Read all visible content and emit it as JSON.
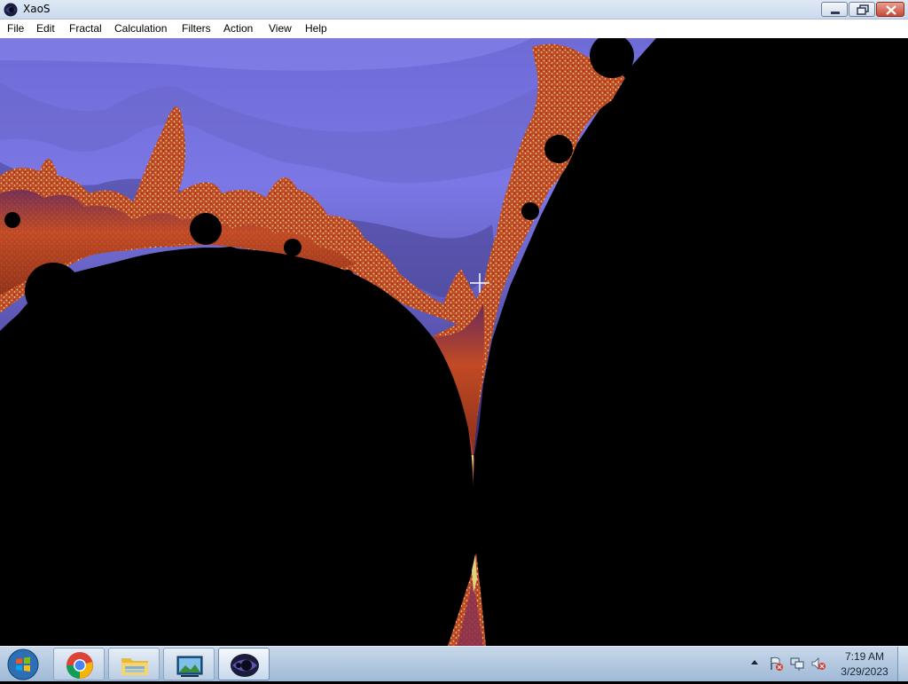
{
  "window": {
    "title": "XaoS",
    "icon": "xaos-app-icon",
    "controls": [
      "minimize-icon",
      "restore-icon",
      "close-icon"
    ]
  },
  "menu": {
    "items": [
      "File",
      "Edit",
      "Fractal",
      "Calculation",
      "Filters",
      "Action",
      "View",
      "Help"
    ]
  },
  "canvas": {
    "content": "mandelbrot-fractal",
    "cursor": "crosshair-icon",
    "colors": {
      "background": "#000000",
      "lavender_light": "#7b78e6",
      "lavender_mid": "#6a66c8",
      "lavender_dark": "#4a4495",
      "purple_deep": "#2f2566",
      "orange": "#c24a24",
      "orange_dark": "#8a2e18",
      "yellow_speckle": "#e0d27a"
    }
  },
  "taskbar": {
    "start_icon": "windows-start-icon",
    "apps": [
      {
        "name": "chrome",
        "icon": "chrome-icon"
      },
      {
        "name": "explorer",
        "icon": "folder-icon"
      },
      {
        "name": "photos",
        "icon": "picture-icon"
      },
      {
        "name": "xaos",
        "icon": "xaos-icon",
        "active": true
      }
    ],
    "tray": {
      "arrow_icon": "tray-up-arrow-icon",
      "icons": [
        "action-center-flag-icon",
        "network-icon",
        "volume-muted-icon"
      ],
      "time": "7:19 AM",
      "date": "3/29/2023"
    }
  }
}
